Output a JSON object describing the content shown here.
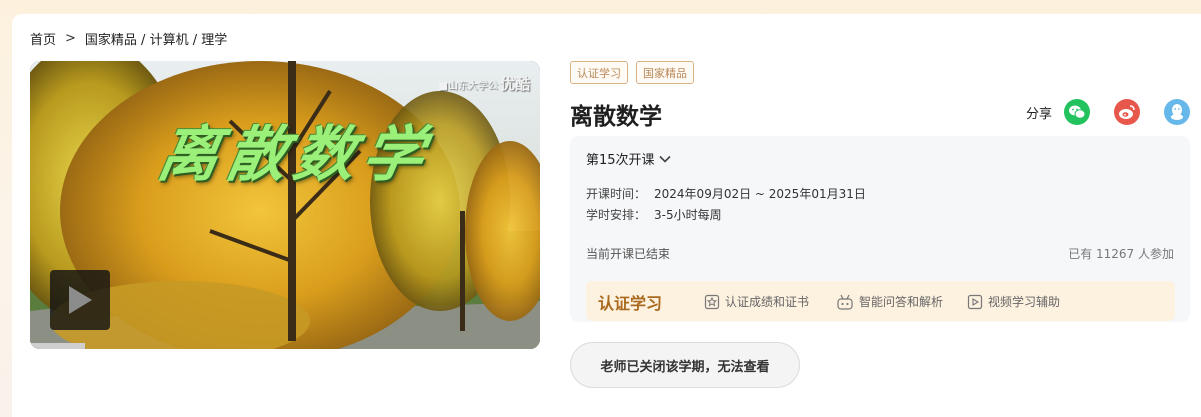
{
  "breadcrumb": {
    "home": "首页",
    "separator": ">",
    "category_path": "国家精品 / 计算机 / 理学"
  },
  "video": {
    "overlay_title": "离散数学",
    "watermark_text": "■山东大学公",
    "watermark_brand": "优酷",
    "play_icon": "play-icon"
  },
  "tags": [
    "认证学习",
    "国家精品"
  ],
  "course": {
    "title": "离散数学"
  },
  "share": {
    "label": "分享",
    "icons": [
      "wechat-icon",
      "weibo-icon",
      "qq-icon"
    ],
    "colors": {
      "wechat": "#22c35e",
      "weibo": "#e8574c",
      "qq": "#67b8ea"
    }
  },
  "term": {
    "label": "第15次开课",
    "course_time_label": "开课时间：",
    "course_time_value": "2024年09月02日 ~ 2025年01月31日",
    "schedule_label": "学时安排：",
    "schedule_value": "3-5小时每周",
    "status": "当前开课已结束",
    "participants": "已有 11267 人参加"
  },
  "certification": {
    "title": "认证学习",
    "features": [
      {
        "label": "认证成绩和证书",
        "icon": "certificate-icon"
      },
      {
        "label": "智能问答和解析",
        "icon": "robot-icon"
      },
      {
        "label": "视频学习辅助",
        "icon": "video-icon"
      }
    ],
    "accent_color": "#a96a1f"
  },
  "closed_notice": "老师已关闭该学期，无法查看"
}
